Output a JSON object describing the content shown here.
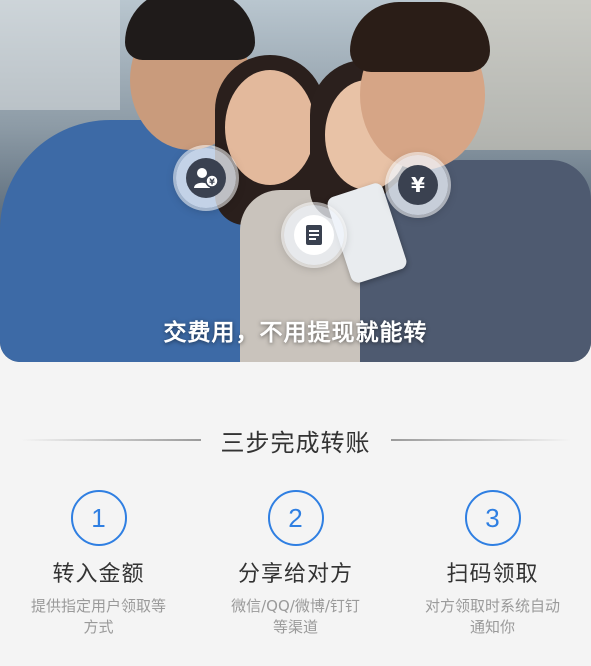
{
  "hero": {
    "caption": "交费用，不用提现就能转",
    "icons": [
      "users-yen-icon",
      "document-icon",
      "yen-icon"
    ]
  },
  "section": {
    "title": "三步完成转账"
  },
  "steps": [
    {
      "number": "1",
      "title": "转入金额",
      "desc_line1": "提供指定用户领取等",
      "desc_line2": "方式"
    },
    {
      "number": "2",
      "title": "分享给对方",
      "desc_line1": "微信/QQ/微博/钉钉",
      "desc_line2": "等渠道"
    },
    {
      "number": "3",
      "title": "扫码领取",
      "desc_line1": "对方领取时系统自动",
      "desc_line2": "通知你"
    }
  ],
  "colors": {
    "accent": "#2f7fe2",
    "background": "#f4f4f4",
    "text": "#333333",
    "muted": "#9a9a9a"
  }
}
